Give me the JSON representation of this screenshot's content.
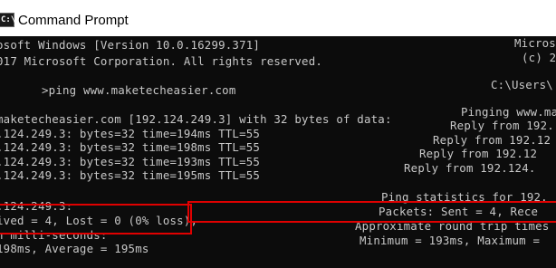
{
  "window": {
    "title": "Command Prompt"
  },
  "left_pane": {
    "lines": [
      "osoft Windows [Version 10.0.16299.371]",
      "017 Microsoft Corporation. All rights reserved.",
      ">ping www.maketecheasier.com",
      "maketecheasier.com [192.124.249.3] with 32 bytes of data:",
      ".124.249.3: bytes=32 time=194ms TTL=55",
      ".124.249.3: bytes=32 time=198ms TTL=55",
      ".124.249.3: bytes=32 time=193ms TTL=55",
      ".124.249.3: bytes=32 time=195ms TTL=55",
      ".124.249.3:",
      "ived = 4, Lost = 0 (0% loss),",
      "n milli-seconds:",
      "198ms, Average = 195ms"
    ]
  },
  "right_pane": {
    "lines": [
      "Micros",
      "(c) 2",
      "C:\\Users\\",
      "Pinging www.ma",
      "Reply from 192.",
      "Reply from 192.12",
      "Reply from 192.12",
      "Reply from 192.124.",
      "Ping statistics for 192.",
      "Packets: Sent = 4, Rece",
      "Approximate round trip times",
      "Minimum = 193ms, Maximum ="
    ]
  },
  "colors": {
    "background": "#0c0c0c",
    "text": "#c8c8c8",
    "highlight": "#e00000"
  }
}
